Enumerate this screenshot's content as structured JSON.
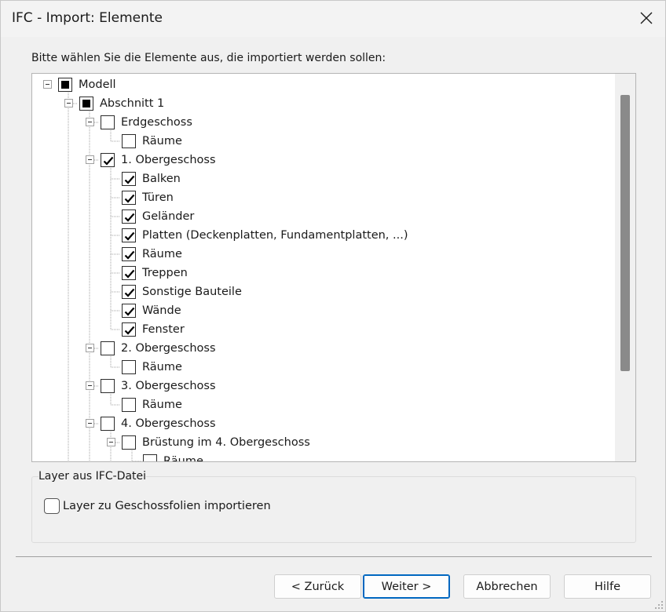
{
  "window": {
    "title": "IFC - Import: Elemente"
  },
  "instruction": "Bitte wählen Sie die Elemente aus, die importiert werden sollen:",
  "tree": [
    {
      "label": "Modell",
      "level": 0,
      "state": "partial",
      "expandable": true
    },
    {
      "label": "Abschnitt 1",
      "level": 1,
      "state": "partial",
      "expandable": true
    },
    {
      "label": "Erdgeschoss",
      "level": 2,
      "state": "unchecked",
      "expandable": true
    },
    {
      "label": "Räume",
      "level": 3,
      "state": "unchecked",
      "expandable": false
    },
    {
      "label": "1. Obergeschoss",
      "level": 2,
      "state": "checked",
      "expandable": true
    },
    {
      "label": "Balken",
      "level": 3,
      "state": "checked",
      "expandable": false
    },
    {
      "label": "Türen",
      "level": 3,
      "state": "checked",
      "expandable": false
    },
    {
      "label": "Geländer",
      "level": 3,
      "state": "checked",
      "expandable": false
    },
    {
      "label": "Platten (Deckenplatten, Fundamentplatten, ...)",
      "level": 3,
      "state": "checked",
      "expandable": false
    },
    {
      "label": "Räume",
      "level": 3,
      "state": "checked",
      "expandable": false
    },
    {
      "label": "Treppen",
      "level": 3,
      "state": "checked",
      "expandable": false
    },
    {
      "label": "Sonstige Bauteile",
      "level": 3,
      "state": "checked",
      "expandable": false
    },
    {
      "label": "Wände",
      "level": 3,
      "state": "checked",
      "expandable": false
    },
    {
      "label": "Fenster",
      "level": 3,
      "state": "checked",
      "expandable": false
    },
    {
      "label": "2. Obergeschoss",
      "level": 2,
      "state": "unchecked",
      "expandable": true
    },
    {
      "label": "Räume",
      "level": 3,
      "state": "unchecked",
      "expandable": false
    },
    {
      "label": "3. Obergeschoss",
      "level": 2,
      "state": "unchecked",
      "expandable": true
    },
    {
      "label": "Räume",
      "level": 3,
      "state": "unchecked",
      "expandable": false
    },
    {
      "label": "4. Obergeschoss",
      "level": 2,
      "state": "unchecked",
      "expandable": true
    },
    {
      "label": "Brüstung im 4. Obergeschoss",
      "level": 3,
      "state": "unchecked",
      "expandable": true
    },
    {
      "label": "Räume",
      "level": 4,
      "state": "unchecked",
      "expandable": false
    }
  ],
  "layer_group": {
    "title": "Layer aus IFC-Datei",
    "checkbox_label": "Layer zu Geschossfolien importieren",
    "checked": false
  },
  "buttons": {
    "back": "< Zurück",
    "next": "Weiter >",
    "cancel": "Abbrechen",
    "help": "Hilfe"
  },
  "colors": {
    "accent": "#0067c0",
    "scroll_thumb": "#8a8a8a"
  }
}
